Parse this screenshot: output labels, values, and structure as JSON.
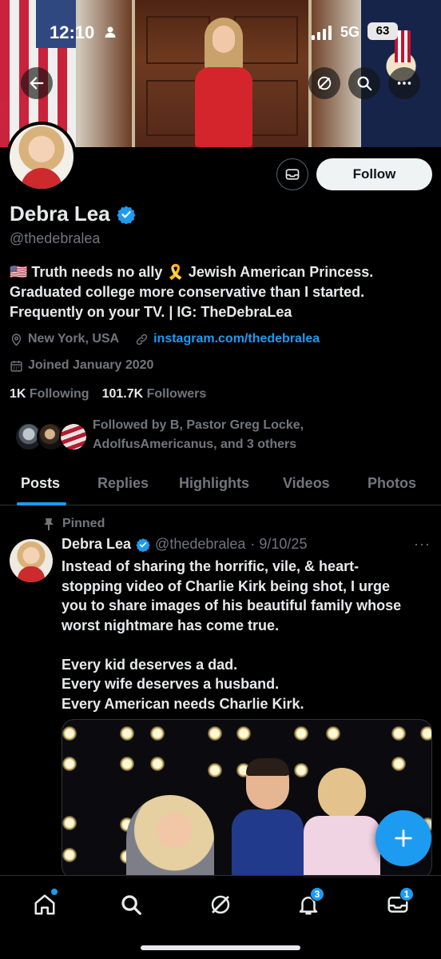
{
  "status_bar": {
    "time": "12:10",
    "network": "5G",
    "battery": "63"
  },
  "profile": {
    "display_name": "Debra Lea",
    "handle": "@thedebralea",
    "bio_line1": "🇺🇸 Truth needs no ally 🎗️ Jewish American Princess.",
    "bio_line2": "Graduated college more conservative than I started.",
    "bio_line3": "Frequently on your TV. | IG: TheDebraLea",
    "location": "New York, USA",
    "website": "instagram.com/thedebralea",
    "joined": "Joined January 2020",
    "following_count": "1K",
    "following_label": "Following",
    "followers_count": "101.7K",
    "followers_label": "Followers",
    "followed_by_line1": "Followed by B, Pastor Greg Locke,",
    "followed_by_line2": "AdolfusAmericanus, and 3 others",
    "follow_label": "Follow"
  },
  "tabs": [
    {
      "label": "Posts",
      "active": true
    },
    {
      "label": "Replies",
      "active": false
    },
    {
      "label": "Highlights",
      "active": false
    },
    {
      "label": "Videos",
      "active": false
    },
    {
      "label": "Photos",
      "active": false
    }
  ],
  "pinned_post": {
    "pinned_label": "Pinned",
    "author_name": "Debra Lea",
    "author_handle": "@thedebralea",
    "date": "· 9/10/25",
    "more": "···",
    "text_p1_l1": "Instead of sharing the horrific, vile, & heart-",
    "text_p1_l2": "stopping video of Charlie Kirk being shot, I urge",
    "text_p1_l3": "you to share images of his beautiful family whose",
    "text_p1_l4": "worst nightmare has come true.",
    "text_p2_l1": "Every kid deserves a dad.",
    "text_p2_l2": "Every wife deserves a husband.",
    "text_p2_l3": "Every American needs Charlie Kirk."
  },
  "bottom_nav": {
    "notifications_badge": "3",
    "messages_badge": "1"
  },
  "colors": {
    "accent": "#1d9bf0",
    "background": "#000000",
    "muted": "#71767b",
    "text": "#e7e9ea"
  },
  "icons": [
    "back-arrow-icon",
    "grok-icon",
    "search-icon",
    "more-icon",
    "mail-icon",
    "verified-icon",
    "location-icon",
    "link-icon",
    "calendar-icon",
    "pin-icon",
    "plus-icon",
    "home-icon",
    "bell-icon"
  ]
}
